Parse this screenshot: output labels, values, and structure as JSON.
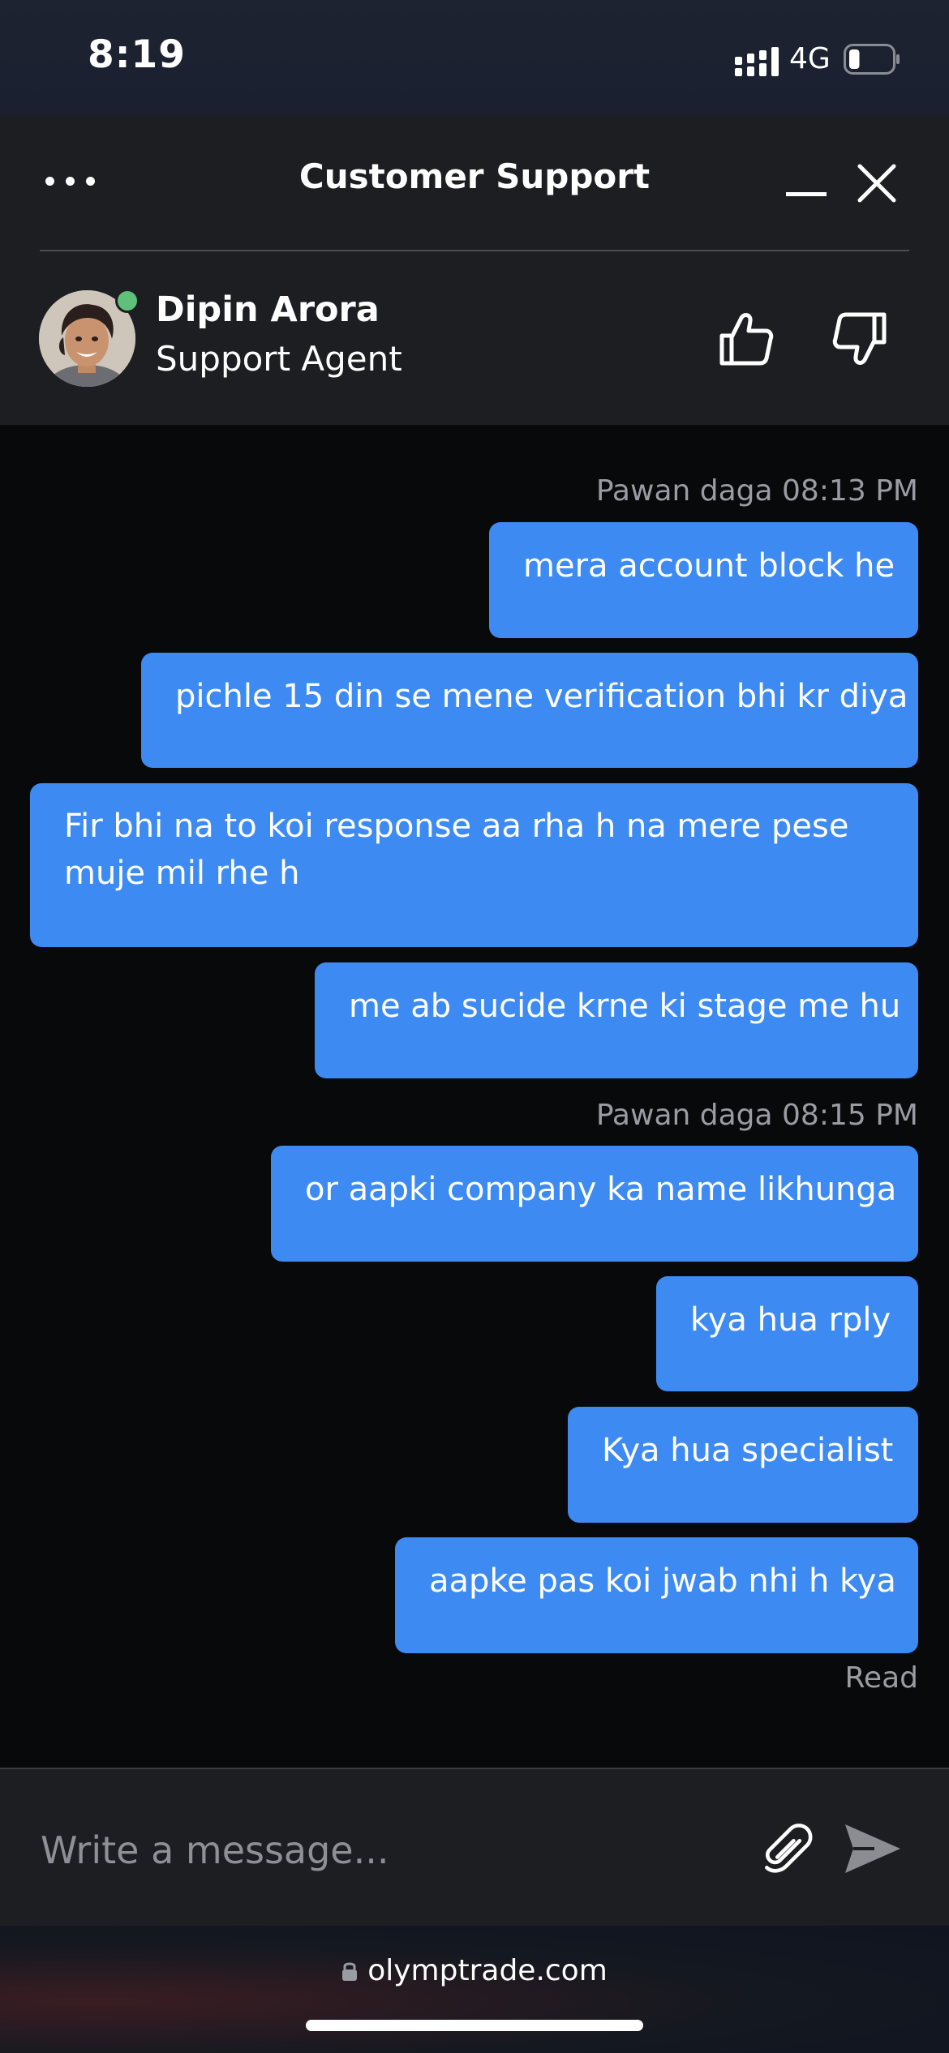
{
  "status_bar": {
    "time": "8:19",
    "network": "4G",
    "battery_level": 0.25
  },
  "header": {
    "title": "Customer Support",
    "agent": {
      "name": "Dipin Arora",
      "role": "Support Agent",
      "status": "online"
    }
  },
  "messages": {
    "groups": [
      {
        "meta": "Pawan daga 08:13 PM",
        "bubbles": [
          "mera account block he",
          "pichle 15 din se mene verification bhi kr diya",
          "Fir bhi na to koi response aa rha h na mere pese muje mil rhe h",
          "me ab sucide krne ki stage me hu"
        ]
      },
      {
        "meta": "Pawan daga 08:15 PM",
        "bubbles": [
          "or aapki company ka name likhunga",
          "kya hua rply",
          "Kya hua specialist",
          "aapke pas koi jwab nhi h kya"
        ]
      }
    ],
    "read_status": "Read"
  },
  "composer": {
    "placeholder": "Write a message..."
  },
  "browser": {
    "url": "olymptrade.com"
  },
  "colors": {
    "bubble": "#3d8bf2",
    "header_bg": "#1d1e22",
    "chat_bg": "#08090b",
    "online": "#5fc07a"
  },
  "icons": {
    "menu": "more-horizontal-icon",
    "minimize": "minimize-icon",
    "close": "close-icon",
    "like": "thumbs-up-icon",
    "dislike": "thumbs-down-icon",
    "attach": "paperclip-icon",
    "send": "send-icon",
    "lock": "lock-icon"
  }
}
